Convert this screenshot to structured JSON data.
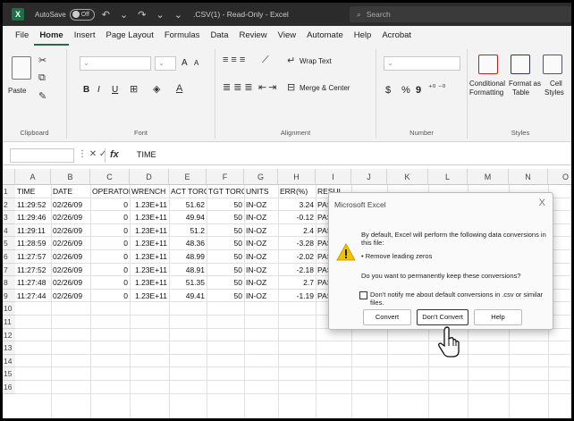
{
  "titlebar": {
    "autosave_label": "AutoSave",
    "autosave_state": "Off",
    "doc_title": ".CSV(1) - Read-Only - Excel",
    "search_placeholder": "Search"
  },
  "menu": {
    "tabs": [
      "File",
      "Home",
      "Insert",
      "Page Layout",
      "Formulas",
      "Data",
      "Review",
      "View",
      "Automate",
      "Help",
      "Acrobat"
    ],
    "active": "Home"
  },
  "ribbon": {
    "clipboard": {
      "paste": "Paste",
      "label": "Clipboard"
    },
    "font": {
      "label": "Font",
      "bold": "B",
      "italic": "I",
      "underline": "U",
      "grow": "A",
      "shrink": "A"
    },
    "alignment": {
      "wrap_text": "Wrap Text",
      "merge_center": "Merge & Center",
      "label": "Alignment"
    },
    "number": {
      "currency": "$",
      "percent": "%",
      "comma": "9",
      "label": "Number"
    },
    "styles": {
      "conditional": "Conditional",
      "formatting": "Formatting",
      "format_as": "Format as",
      "table": "Table",
      "cell": "Cell",
      "cell_styles": "Styles",
      "label": "Styles"
    }
  },
  "formula_bar": {
    "fx": "fx",
    "content": "TIME"
  },
  "grid": {
    "columns": [
      "A",
      "B",
      "C",
      "D",
      "E",
      "F",
      "G",
      "H",
      "I",
      "J",
      "K",
      "L",
      "M",
      "N",
      "O"
    ],
    "rows": [
      "1",
      "2",
      "3",
      "4",
      "5",
      "6",
      "7",
      "8",
      "9",
      "10",
      "11",
      "12",
      "13",
      "14",
      "15",
      "16"
    ],
    "header": [
      "TIME",
      "DATE",
      "OPERATOI",
      "WRENCH",
      "ACT TORQ",
      "TGT TORQ",
      "UNITS",
      "ERR(%)",
      "RESUL"
    ],
    "data": [
      [
        "11:29:52",
        "02/26/09",
        "0",
        "1.23E+11",
        "51.62",
        "50",
        "IN-OZ",
        "3.24",
        "PASS"
      ],
      [
        "11:29:46",
        "02/26/09",
        "0",
        "1.23E+11",
        "49.94",
        "50",
        "IN-OZ",
        "-0.12",
        "PASS"
      ],
      [
        "11:29:11",
        "02/26/09",
        "0",
        "1.23E+11",
        "51.2",
        "50",
        "IN-OZ",
        "2.4",
        "PASS"
      ],
      [
        "11:28:59",
        "02/26/09",
        "0",
        "1.23E+11",
        "48.36",
        "50",
        "IN-OZ",
        "-3.28",
        "PASS"
      ],
      [
        "11:27:57",
        "02/26/09",
        "0",
        "1.23E+11",
        "48.99",
        "50",
        "IN-OZ",
        "-2.02",
        "PASS"
      ],
      [
        "11:27:52",
        "02/26/09",
        "0",
        "1.23E+11",
        "48.91",
        "50",
        "IN-OZ",
        "-2.18",
        "PASS"
      ],
      [
        "11:27:48",
        "02/26/09",
        "0",
        "1.23E+11",
        "51.35",
        "50",
        "IN-OZ",
        "2.7",
        "PASS"
      ],
      [
        "11:27:44",
        "02/26/09",
        "0",
        "1.23E+11",
        "49.41",
        "50",
        "IN-OZ",
        "-1.19",
        "PASS"
      ]
    ]
  },
  "dialog": {
    "title": "Microsoft Excel",
    "close": "X",
    "line1": "By default, Excel will perform the following data conversions in this file:",
    "line2": "• Remove leading zeros",
    "line3": "Do you want to permanently keep these conversions?",
    "checkbox_label": "Don't notify me about default conversions in .csv or similar files.",
    "buttons": {
      "convert": "Convert",
      "dont_convert": "Don't Convert",
      "help": "Help"
    }
  },
  "colors": {
    "excel_green": "#1d7044",
    "warning": "#f2c200"
  }
}
